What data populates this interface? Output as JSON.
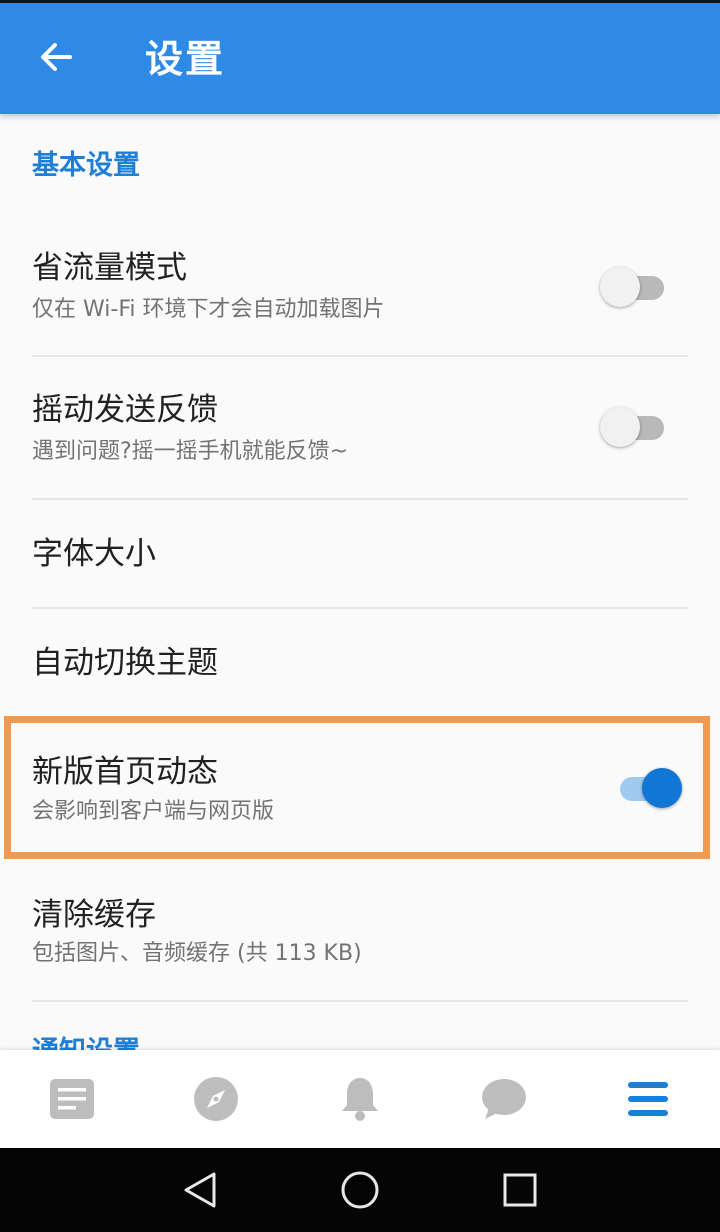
{
  "toolbar": {
    "back_icon": "arrow-back-icon",
    "title": "设置",
    "background_color": "#2f8ae5"
  },
  "sections": [
    {
      "header": "基本设置",
      "items": [
        {
          "title": "省流量模式",
          "subtitle": "仅在 Wi-Fi 环境下才会自动加载图片",
          "toggle": false
        },
        {
          "title": "摇动发送反馈",
          "subtitle": "遇到问题?摇一摇手机就能反馈~",
          "toggle": false
        },
        {
          "title": "字体大小"
        },
        {
          "title": "自动切换主题"
        },
        {
          "title": "新版首页动态",
          "subtitle": "会影响到客户端与网页版",
          "toggle": true,
          "highlighted": true
        },
        {
          "title": "清除缓存",
          "subtitle": "包括图片、音频缓存 (共 113 KB)"
        }
      ]
    },
    {
      "header": "通知设置"
    }
  ],
  "bottom_nav": [
    {
      "icon": "feed-icon",
      "active": false
    },
    {
      "icon": "compass-icon",
      "active": false
    },
    {
      "icon": "bell-icon",
      "active": false
    },
    {
      "icon": "chat-bubble-icon",
      "active": false
    },
    {
      "icon": "menu-icon",
      "active": true
    }
  ],
  "system_nav": [
    "back-triangle-icon",
    "home-circle-icon",
    "recents-square-icon"
  ],
  "colors": {
    "accent": "#1f7fd6",
    "switch_on": "#1176d4",
    "highlight_border": "#f0994f",
    "inactive_icon": "#bdbdbd"
  }
}
